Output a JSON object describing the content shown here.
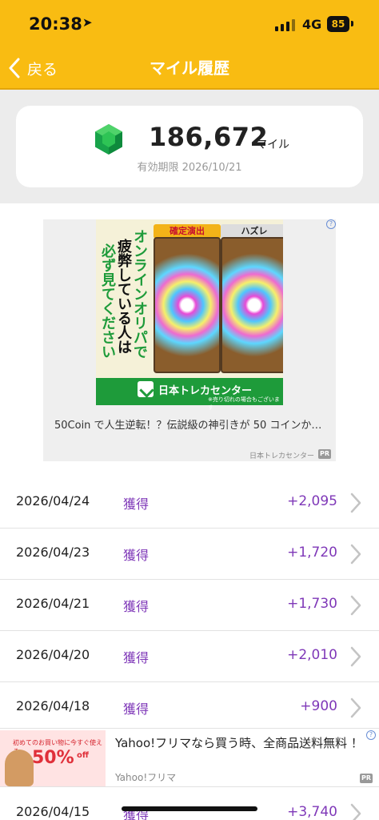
{
  "status_bar": {
    "time": "20:38",
    "network": "4G",
    "battery": "85"
  },
  "nav": {
    "back_label": "戻る",
    "title": "マイル履歴"
  },
  "balance": {
    "value": "186,672",
    "unit": "マイル",
    "expiry": "有効期限 2026/10/21"
  },
  "ad1": {
    "tag_left": "確定演出",
    "tag_right": "ハズレ",
    "vertical_text": [
      "オンラインオリパで",
      "疲弊している人は",
      "必ず見てください"
    ],
    "brand": "日本トレカセンター",
    "fine_print": "※売り切れの場合もございます",
    "headline": "50Coin で人生逆転！？伝説級の神引きが 50 コインか…",
    "sponsor": "日本トレカセンター",
    "pr": "PR"
  },
  "history": [
    {
      "date": "2026/04/24",
      "type": "獲得",
      "amount": "+2,095"
    },
    {
      "date": "2026/04/23",
      "type": "獲得",
      "amount": "+1,720"
    },
    {
      "date": "2026/04/21",
      "type": "獲得",
      "amount": "+1,730"
    },
    {
      "date": "2026/04/20",
      "type": "獲得",
      "amount": "+2,010"
    },
    {
      "date": "2026/04/18",
      "type": "獲得",
      "amount": "+900"
    },
    {
      "date": "2026/04/15",
      "type": "獲得",
      "amount": "+3,740"
    }
  ],
  "ad2": {
    "image_header": "初めてのお買い物に今すぐ使える",
    "image_percent": "50%",
    "image_off": "off",
    "text": "Yahoo!フリマなら買う時、全商品送料無料 ！",
    "brand": "Yahoo!フリマ",
    "pr": "PR"
  },
  "colors": {
    "header": "#f9bc12",
    "accent": "#7f38b8",
    "ad_green": "#1e9b3a"
  },
  "icons": {
    "back": "chevron-left-icon",
    "gem": "emerald-gem-icon",
    "row_disclosure": "chevron-right-icon"
  }
}
